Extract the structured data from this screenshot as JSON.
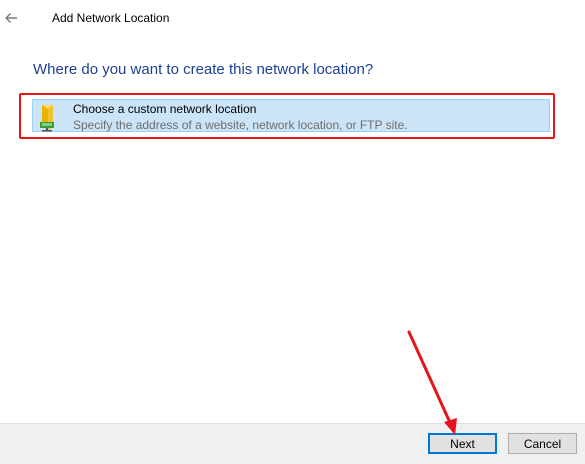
{
  "window": {
    "title": "Add Network Location",
    "back_icon": "back-arrow-icon"
  },
  "main": {
    "heading": "Where do you want to create this network location?",
    "options": [
      {
        "title": "Choose a custom network location",
        "description": "Specify the address of a website, network location, or FTP site.",
        "icon": "network-folder-icon",
        "selected": true
      }
    ]
  },
  "footer": {
    "next_label": "Next",
    "cancel_label": "Cancel"
  },
  "annotations": {
    "highlight_color": "#e8141c",
    "arrow_color": "#e8141c",
    "arrow_icon": "pointer-arrow"
  },
  "colors": {
    "heading": "#1c3f95",
    "selection_bg": "#cce4f7",
    "selection_border": "#99d1ff",
    "default_button_border": "#0078d7"
  }
}
